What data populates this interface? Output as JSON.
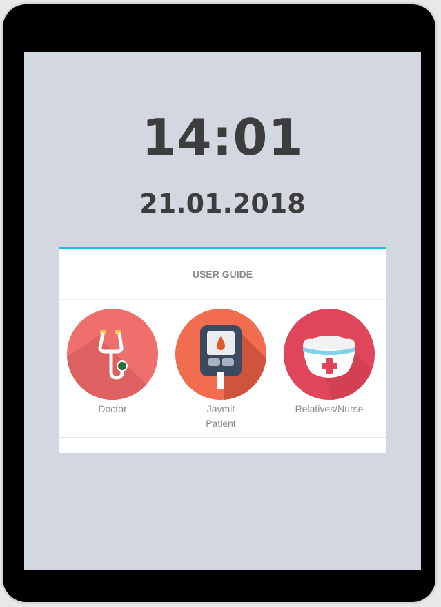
{
  "clock": {
    "time": "14:01",
    "date": "21.01.2018"
  },
  "user_guide": {
    "title": "USER GUIDE",
    "roles": [
      {
        "id": "doctor",
        "label": "Doctor",
        "icon": "stethoscope-icon",
        "color": "#ef6f6c"
      },
      {
        "id": "patient",
        "label_line1": "Jaymit",
        "label_line2": "Patient",
        "icon": "glucose-meter-icon",
        "color": "#f26d50"
      },
      {
        "id": "nurse",
        "label": "Relatives/Nurse",
        "icon": "nurse-cap-icon",
        "color": "#e0465b"
      }
    ]
  },
  "colors": {
    "screen_background": "#d3d7e0",
    "card_accent": "#1ebde6",
    "text_dark": "#3d3d3d",
    "text_muted": "#8a8a8a"
  }
}
